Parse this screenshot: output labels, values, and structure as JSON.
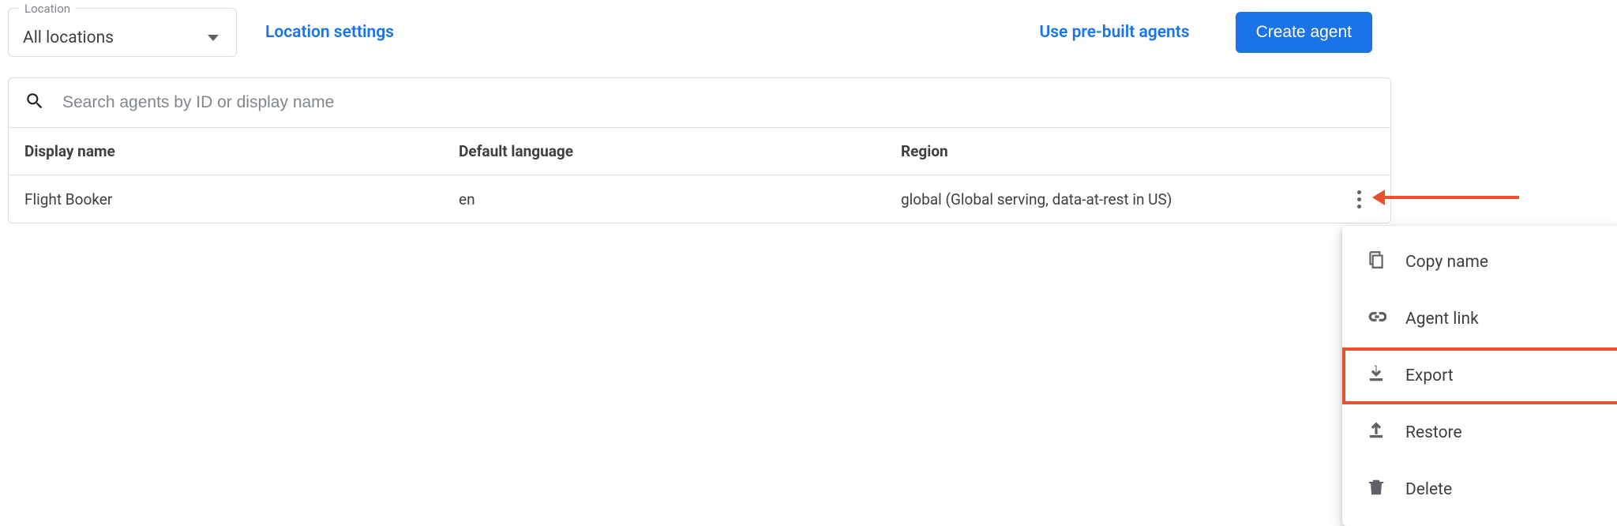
{
  "topbar": {
    "location_label": "Location",
    "location_value": "All locations",
    "location_settings": "Location settings",
    "use_prebuilt": "Use pre-built agents",
    "create_agent": "Create agent"
  },
  "search": {
    "placeholder": "Search agents by ID or display name"
  },
  "table": {
    "headers": {
      "display_name": "Display name",
      "default_language": "Default language",
      "region": "Region"
    },
    "rows": [
      {
        "display_name": "Flight Booker",
        "default_language": "en",
        "region": "global (Global serving, data-at-rest in US)"
      }
    ]
  },
  "menu": {
    "copy_name": "Copy name",
    "agent_link": "Agent link",
    "export": "Export",
    "restore": "Restore",
    "delete": "Delete"
  }
}
